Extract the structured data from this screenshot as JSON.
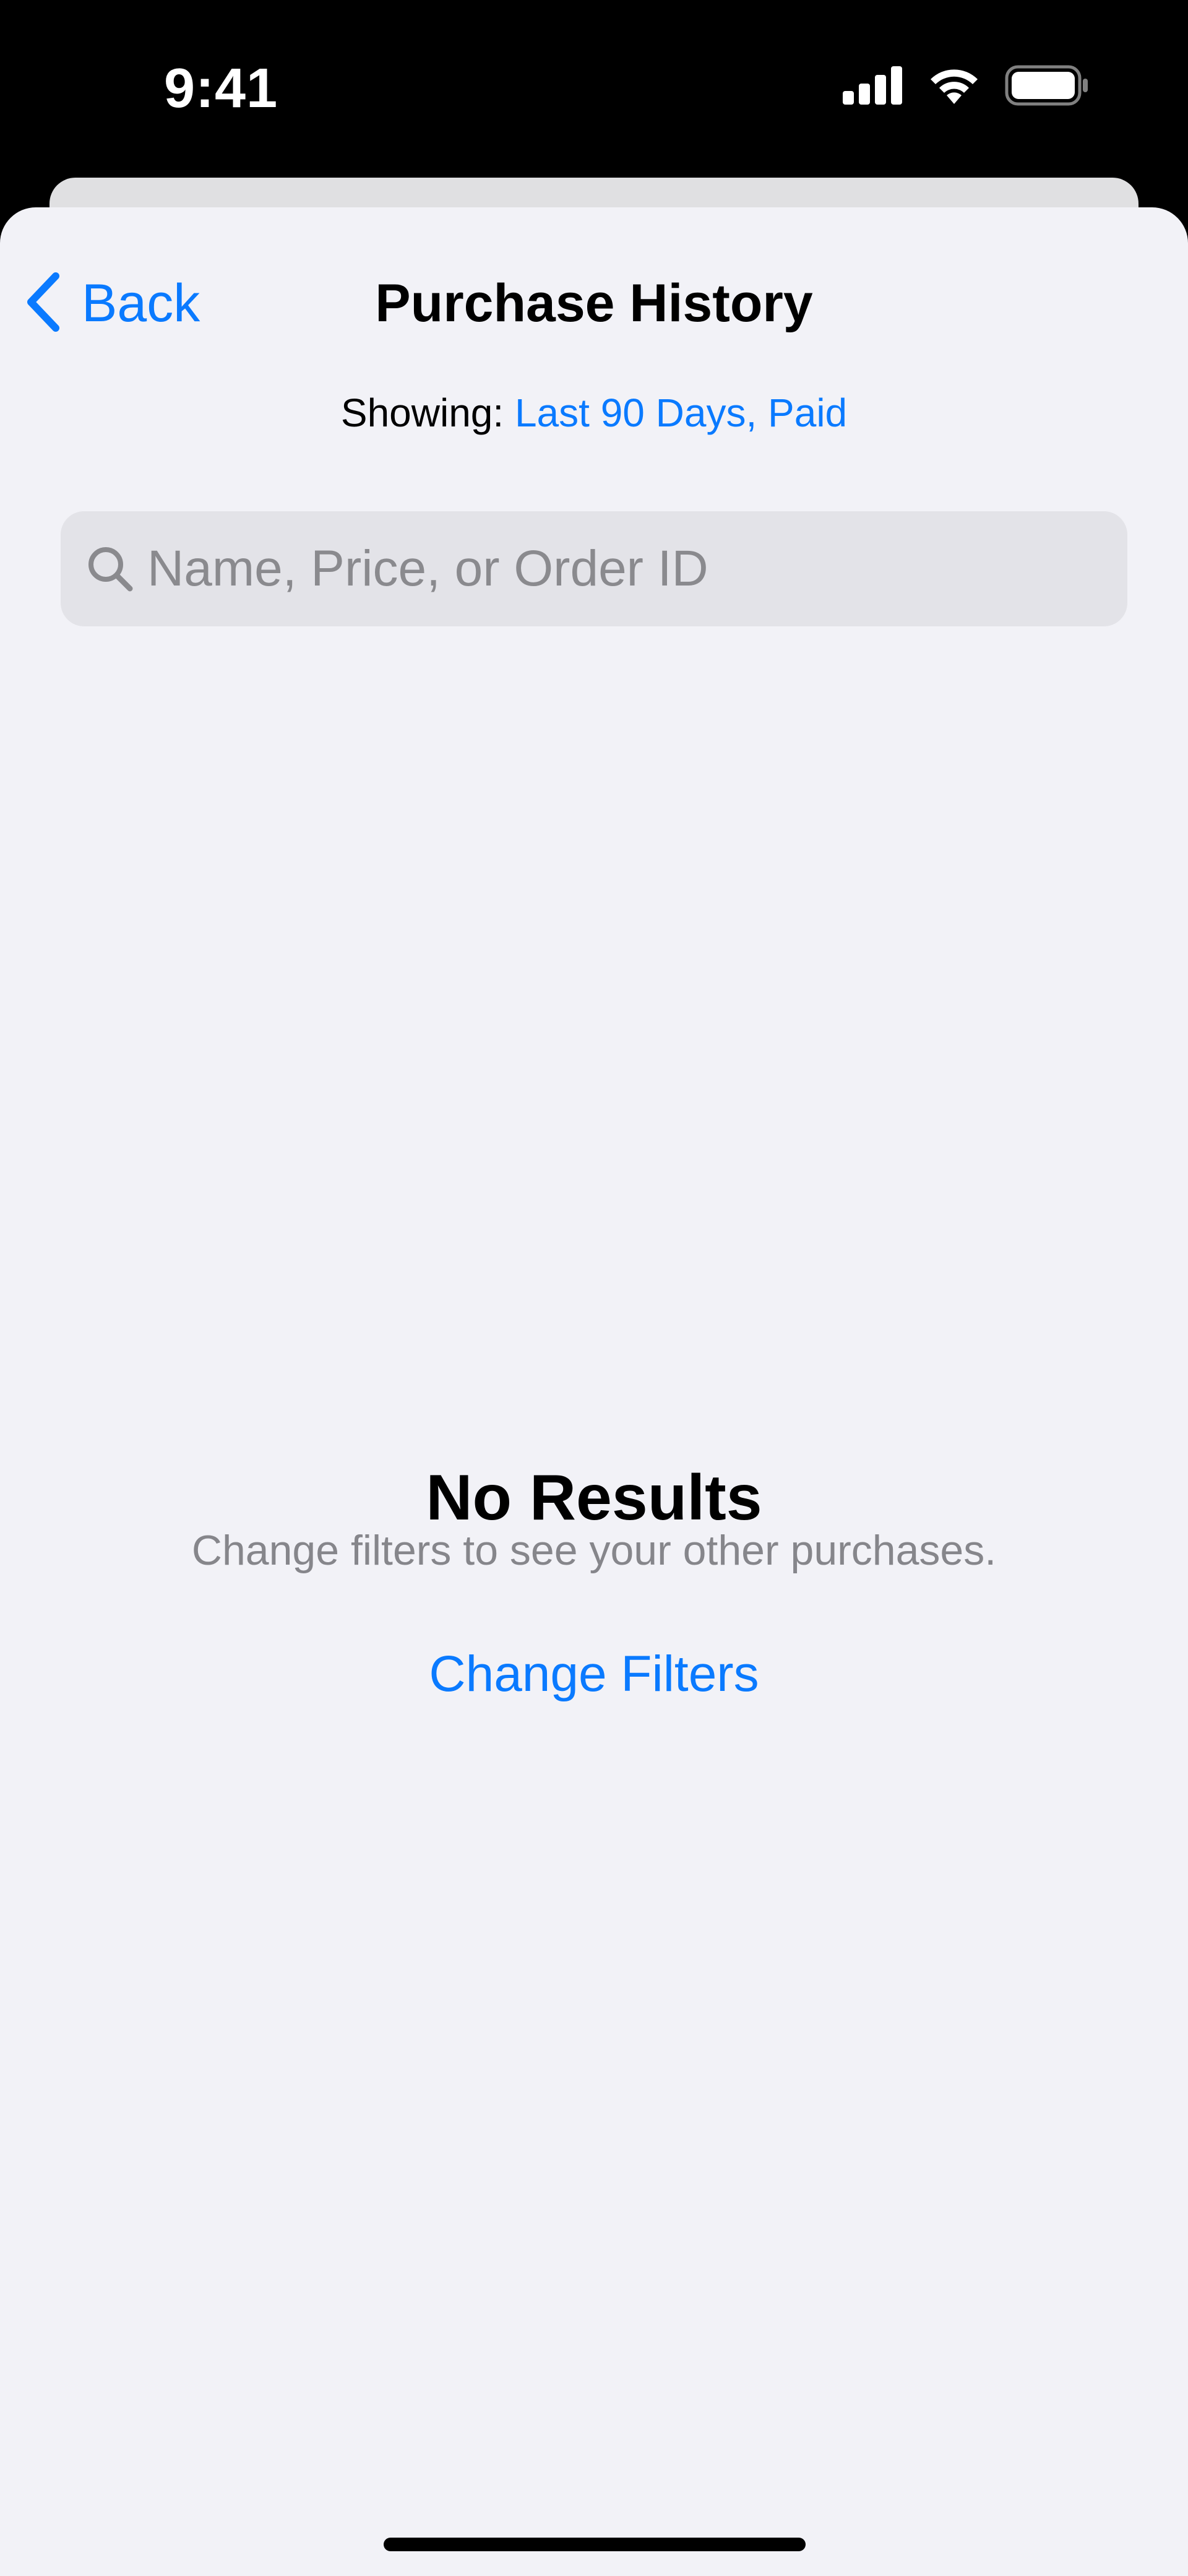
{
  "status_bar": {
    "time": "9:41",
    "icons": [
      "cellular-signal-icon",
      "wifi-icon",
      "battery-icon"
    ]
  },
  "nav": {
    "back_label": "Back",
    "title": "Purchase History"
  },
  "filter_summary": {
    "prefix": "Showing:",
    "value": "Last 90 Days, Paid"
  },
  "search": {
    "placeholder": "Name, Price, or Order ID",
    "value": ""
  },
  "empty_state": {
    "title": "No Results",
    "message": "Change filters to see your other purchases.",
    "action_label": "Change Filters"
  },
  "colors": {
    "accent": "#0a7aff",
    "background": "#f2f2f7",
    "search_field": "#e3e3e8",
    "secondary_text": "#86868b"
  }
}
